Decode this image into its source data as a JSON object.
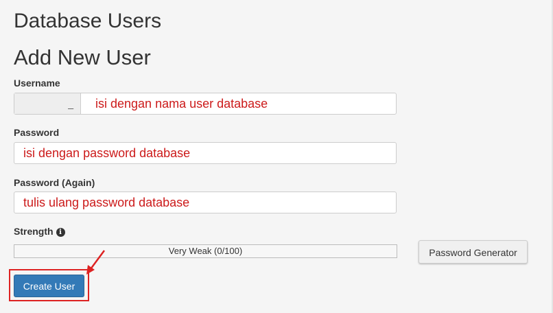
{
  "section_title": "Database Users",
  "form": {
    "title": "Add New User",
    "username": {
      "label": "Username",
      "prefix": "_",
      "hint": "isi dengan nama user database"
    },
    "password": {
      "label": "Password",
      "hint": "isi dengan password database"
    },
    "password_again": {
      "label": "Password (Again)",
      "hint": "tulis ulang password database"
    },
    "strength": {
      "label": "Strength",
      "info_icon": "info-circle-icon",
      "meter_text": "Very Weak (0/100)",
      "score": 0,
      "max": 100
    },
    "generator_button": "Password Generator",
    "create_button": "Create User"
  },
  "colors": {
    "annotation": "#dd2222",
    "primary_button": "#337ab7",
    "page_background": "#f5f5f5"
  }
}
